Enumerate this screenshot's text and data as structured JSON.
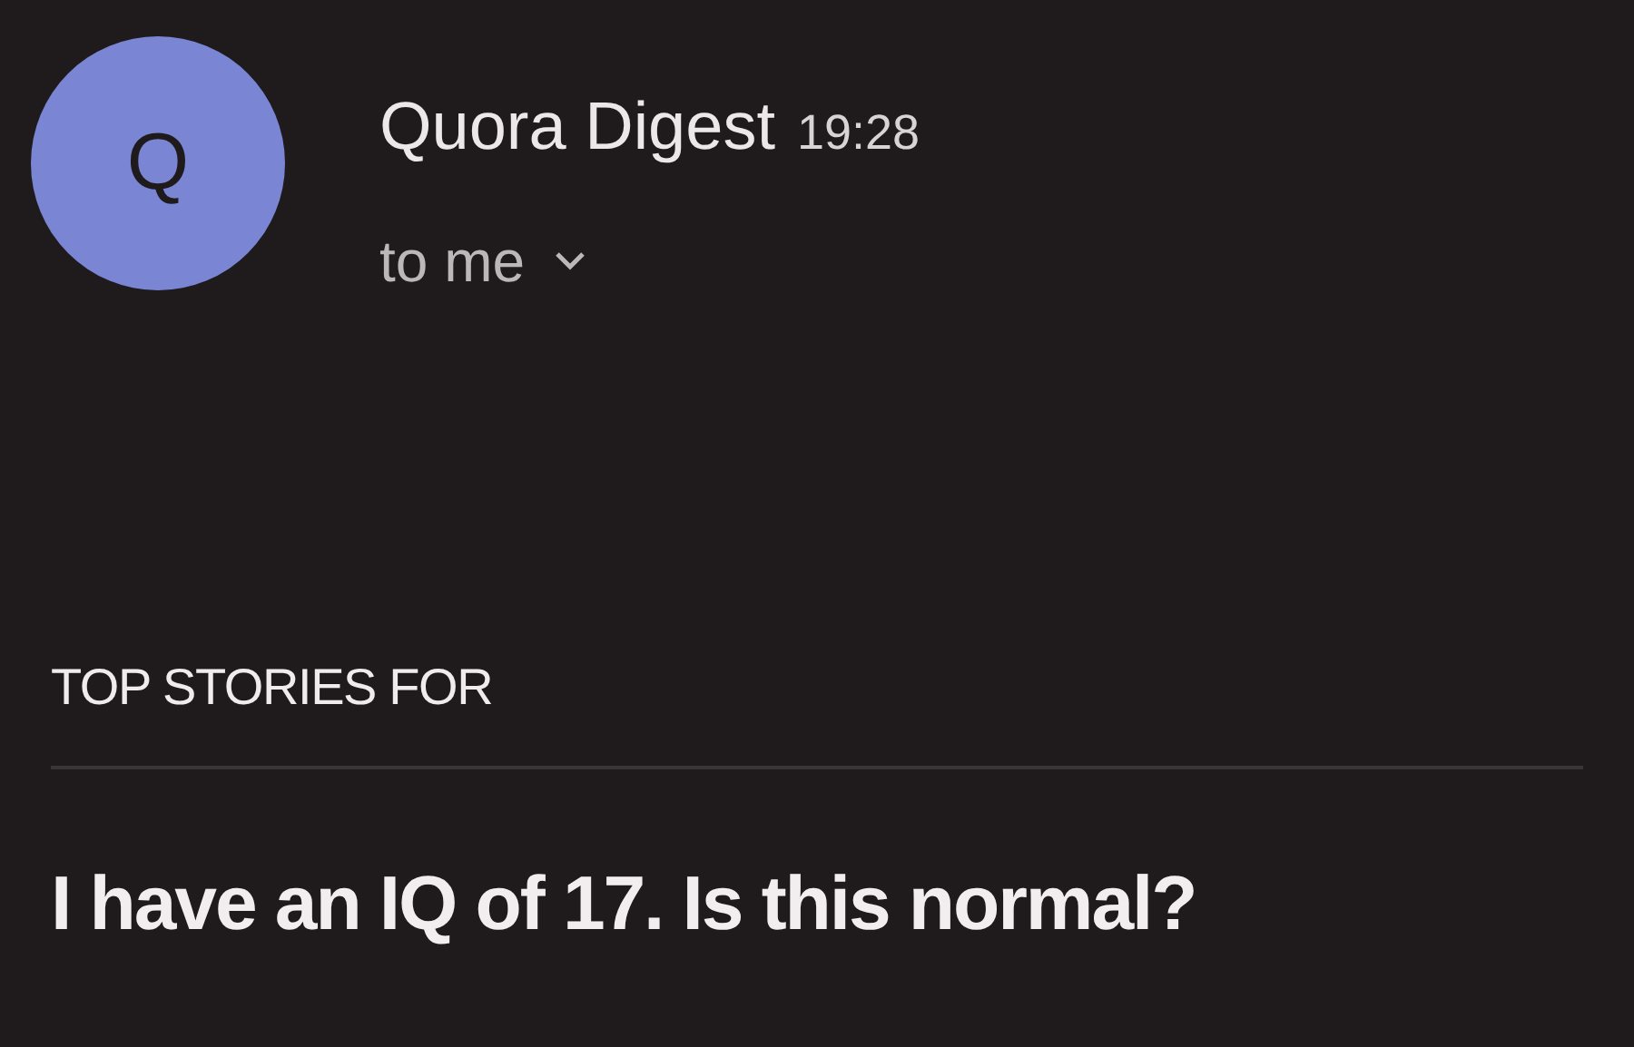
{
  "sender": {
    "avatar_letter": "Q",
    "name": "Quora Digest",
    "time": "19:28",
    "recipient": "to me"
  },
  "section_label": "TOP STORIES FOR",
  "story_title": "I have an IQ of 17. Is this normal?"
}
